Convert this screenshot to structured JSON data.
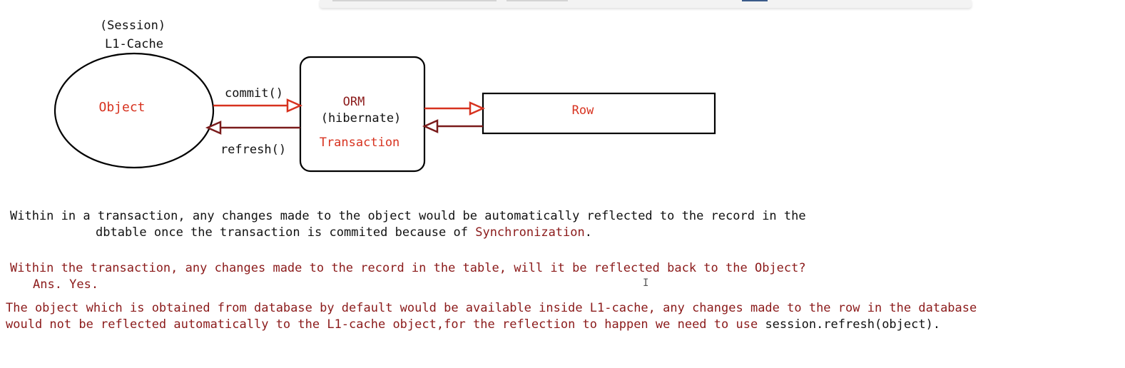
{
  "colors": {
    "outline": "#000000",
    "accent_red": "#d7321f",
    "dark_red": "#7a1b1b",
    "text_dark_red": "#8b1a1a"
  },
  "diagram": {
    "session_label": "(Session)",
    "cache_label": "L1-Cache",
    "object_label": "Object",
    "commit_label": "commit()",
    "refresh_label": "refresh()",
    "orm_label": "ORM",
    "hibernate_label": "(hibernate)",
    "transaction_label": "Transaction",
    "row_label": "Row"
  },
  "notes": {
    "line1": "Within in a transaction, any changes made to the object would be automatically reflected to the record in the",
    "line2_prefix": "dbtable once the transaction is commited because of ",
    "line2_highlight": "Synchronization",
    "line2_suffix": ".",
    "question": "Within the transaction, any changes made to the record in the table, will it be reflected back to the Object?",
    "answer": "Ans. Yes.",
    "explain1": "The object which is obtained from database by default would be available inside L1-cache, any changes made to the row in the database",
    "explain2_prefix": "would not be reflected automatically to the L1-cache object,for the reflection to happen we need to use ",
    "explain2_code": "session.refresh(object)",
    "explain2_suffix": "."
  },
  "cursor_glyph": "I"
}
